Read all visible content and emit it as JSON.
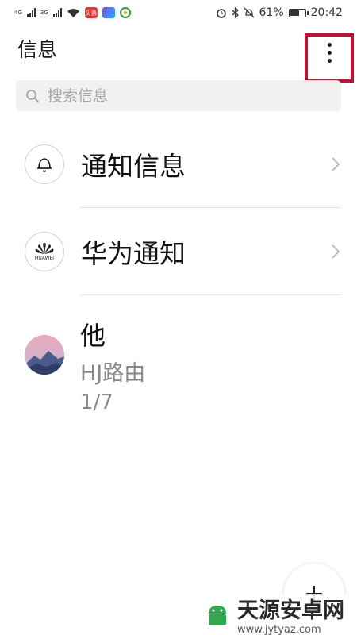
{
  "status_bar": {
    "net1": "4G",
    "net2": "3G",
    "app1_text": "头条",
    "battery_percent": "61%",
    "battery_level": 0.61,
    "time": "20:42"
  },
  "header": {
    "title": "信息",
    "menu_icon": "more-vertical-icon"
  },
  "search": {
    "placeholder": "搜索信息"
  },
  "list": [
    {
      "label": "通知信息",
      "icon": "bell-icon"
    },
    {
      "label": "华为通知",
      "icon": "huawei-logo",
      "logo_text": "HUAWEI"
    }
  ],
  "conversation": {
    "name": "他",
    "preview": "HJ路由",
    "count": "1/7"
  },
  "watermark": {
    "title": "天源安卓网",
    "url": "www.jytyaz.com"
  },
  "colors": {
    "highlight": "#c8102e",
    "search_bg": "#f1f1f1"
  }
}
